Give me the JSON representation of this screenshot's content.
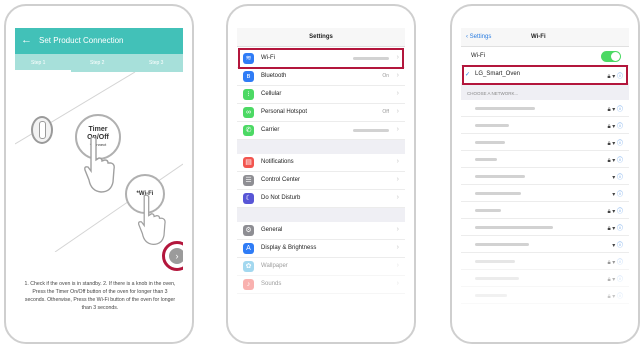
{
  "phone1": {
    "header_title": "Set Product Connection",
    "back_glyph": "←",
    "steps": [
      "Step 1",
      "Step 2",
      "Step 3"
    ],
    "timer_button": {
      "line1": "Timer",
      "line2": "On/Off",
      "line3": "*Connect"
    },
    "wifi_button": "*Wi-Fi",
    "next_glyph": "›",
    "instructions": "1. Check if the oven is in standby. 2. If there is a knob in the oven, Press the Timer On/Off button of the oven for longer than 3 seconds. Otherwise, Press the Wi-Fi button of the oven for longer than 3 seconds.",
    "colors": {
      "header": "#42c1b8",
      "highlight": "#b3163c"
    }
  },
  "phone2": {
    "title": "Settings",
    "group1": [
      {
        "label": "Wi-Fi",
        "icon": "wifi-icon",
        "color": "#2f7cf6",
        "value": ""
      },
      {
        "label": "Bluetooth",
        "icon": "bluetooth-icon",
        "color": "#2f7cf6",
        "value": "On"
      },
      {
        "label": "Cellular",
        "icon": "cellular-icon",
        "color": "#4cd964",
        "value": ""
      },
      {
        "label": "Personal Hotspot",
        "icon": "hotspot-icon",
        "color": "#4cd964",
        "value": "Off"
      },
      {
        "label": "Carrier",
        "icon": "phone-icon",
        "color": "#4cd964",
        "value": ""
      }
    ],
    "group2": [
      {
        "label": "Notifications",
        "icon": "notifications-icon",
        "color": "#f2554f"
      },
      {
        "label": "Control Center",
        "icon": "control-center-icon",
        "color": "#8e8e93"
      },
      {
        "label": "Do Not Disturb",
        "icon": "moon-icon",
        "color": "#5856d6"
      }
    ],
    "group3": [
      {
        "label": "General",
        "icon": "gear-icon",
        "color": "#8e8e93"
      },
      {
        "label": "Display & Brightness",
        "icon": "brightness-icon",
        "color": "#2f7cf6"
      },
      {
        "label": "Wallpaper",
        "icon": "wallpaper-icon",
        "color": "#34aadc"
      },
      {
        "label": "Sounds",
        "icon": "sounds-icon",
        "color": "#f2554f"
      }
    ]
  },
  "phone3": {
    "back_label": "Settings",
    "title": "Wi-Fi",
    "wifi_label": "Wi-Fi",
    "wifi_on": true,
    "connected_network": "LG_Smart_Oven",
    "checkmark": "✓",
    "section_label": "CHOOSE A NETWORK...",
    "network_count": 13
  }
}
